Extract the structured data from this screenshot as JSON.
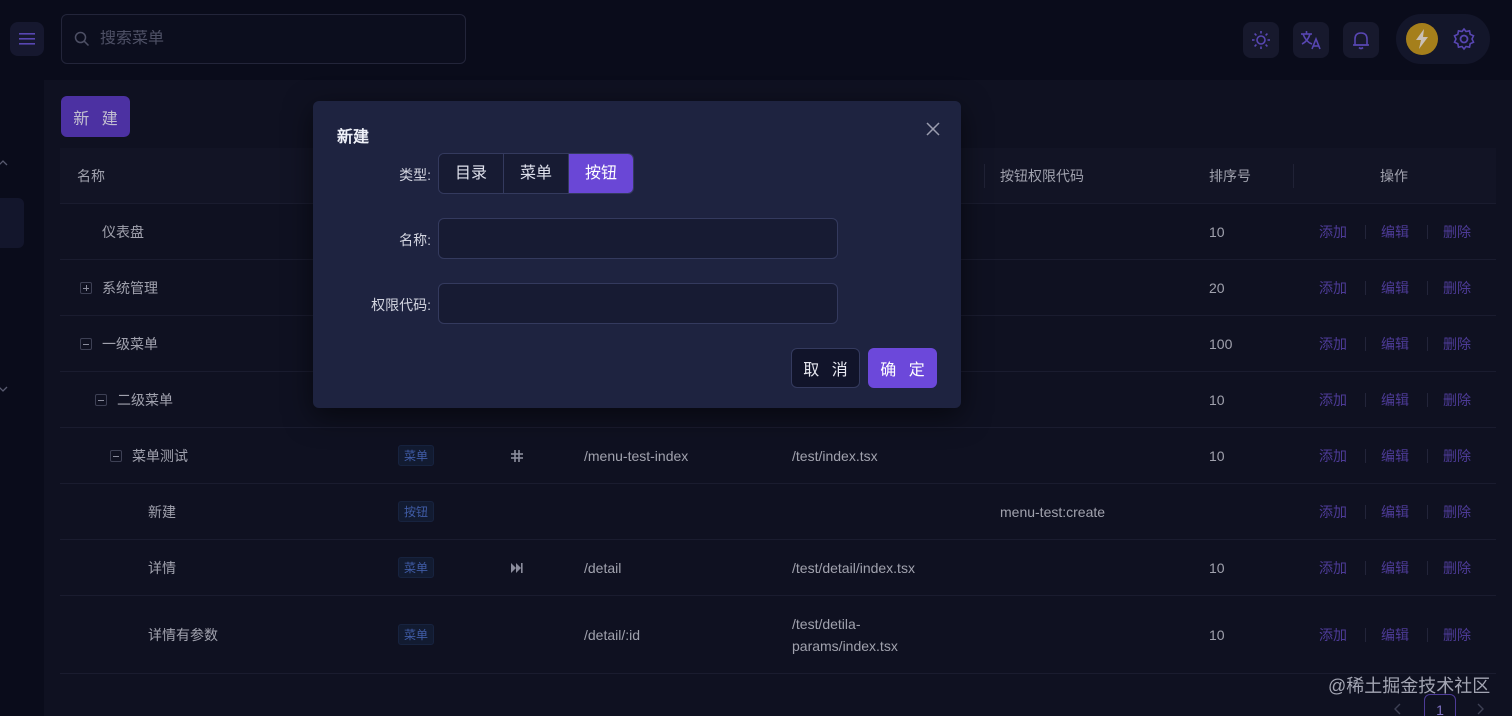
{
  "header": {
    "search_placeholder": "搜索菜单",
    "icons": [
      "menu-icon",
      "search-icon",
      "sun-icon",
      "translate-icon",
      "bell-icon",
      "lightning-icon",
      "gear-icon"
    ]
  },
  "toolbar": {
    "new_label": "新 建"
  },
  "table": {
    "columns": [
      "名称",
      "按钮权限代码",
      "排序号",
      "操作"
    ],
    "rows": [
      {
        "name": "仪表盘",
        "type": "",
        "path": "",
        "component": "",
        "code": "",
        "sort": "10"
      },
      {
        "name": "系统管理",
        "type": "",
        "path": "",
        "component": "",
        "code": "",
        "sort": "20"
      },
      {
        "name": "一级菜单",
        "type": "",
        "path": "",
        "component": "",
        "code": "",
        "sort": "100"
      },
      {
        "name": "二级菜单",
        "type": "",
        "path": "",
        "component": "",
        "code": "",
        "sort": "10"
      },
      {
        "name": "菜单测试",
        "type": "菜单",
        "path": "/menu-test-index",
        "component": "/test/index.tsx",
        "code": "",
        "sort": "10"
      },
      {
        "name": "新建",
        "type": "按钮",
        "path": "",
        "component": "",
        "code": "menu-test:create",
        "sort": ""
      },
      {
        "name": "详情",
        "type": "菜单",
        "path": "/detail",
        "component": "/test/detail/index.tsx",
        "code": "",
        "sort": "10"
      },
      {
        "name": "详情有参数",
        "type": "菜单",
        "path": "/detail/:id",
        "component": "/test/detila-params/index.tsx",
        "code": "",
        "sort": "10"
      }
    ],
    "actions": {
      "add": "添加",
      "edit": "编辑",
      "delete": "删除"
    }
  },
  "pagination": {
    "current": "1"
  },
  "watermark": "@稀土掘金技术社区",
  "modal": {
    "title": "新建",
    "type_label": "类型:",
    "type_options": [
      "目录",
      "菜单",
      "按钮"
    ],
    "type_selected": "按钮",
    "name_label": "名称:",
    "name_value": "",
    "code_label": "权限代码:",
    "code_value": "",
    "cancel_label": "取 消",
    "ok_label": "确 定"
  },
  "colors": {
    "accent": "#6c48da",
    "background": "#121425",
    "modal": "#1e2340",
    "link": "#5d47b5",
    "tag": "#4d6fc7"
  }
}
